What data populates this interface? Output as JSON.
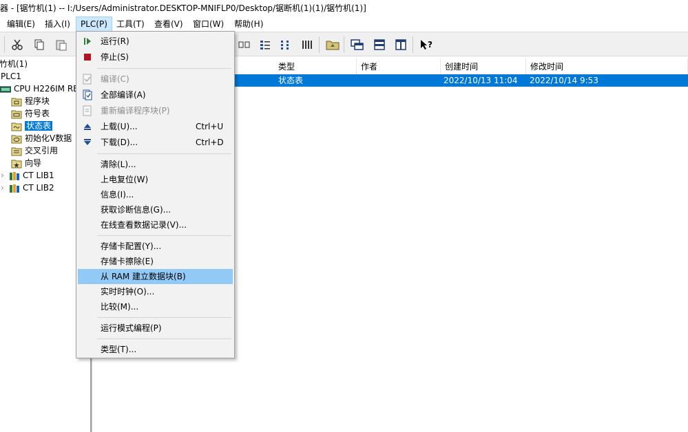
{
  "window": {
    "title": "器 - [锯竹机(1) -- I:/Users/Administrator.DESKTOP-MNIFLP0/Desktop/锯断机(1)(1)/锯竹机(1)]"
  },
  "menubar": {
    "items": [
      "编辑(E)",
      "插入(I)",
      "PLC(P)",
      "工具(T)",
      "查看(V)",
      "窗口(W)",
      "帮助(H)"
    ]
  },
  "tree": {
    "project": "竹机(1)",
    "plc": "PLC1",
    "cpu": "CPU H226IM RE",
    "items": [
      "程序块",
      "符号表",
      "状态表",
      "初始化V数据",
      "交叉引用",
      "向导",
      "CT LIB1",
      "CT LIB2"
    ]
  },
  "table": {
    "headers": [
      "类型",
      "作者",
      "创建时间",
      "修改时间"
    ],
    "rows": [
      {
        "type": "状态表",
        "author": "",
        "created": "2022/10/13 11:04",
        "modified": "2022/10/14 9:53"
      }
    ]
  },
  "plc_menu": {
    "items": [
      {
        "label": "运行(R)",
        "shortcut": "",
        "icon": "run-icon",
        "disabled": false
      },
      {
        "label": "停止(S)",
        "shortcut": "",
        "icon": "stop-icon",
        "disabled": false
      },
      {
        "label": "编译(C)",
        "shortcut": "",
        "icon": "compile-icon",
        "disabled": true
      },
      {
        "label": "全部编译(A)",
        "shortcut": "",
        "icon": "compile-all-icon",
        "disabled": false
      },
      {
        "label": "重新编译程序块(P)",
        "shortcut": "",
        "icon": "recompile-icon",
        "disabled": true
      },
      {
        "label": "上载(U)...",
        "shortcut": "Ctrl+U",
        "icon": "upload-icon",
        "disabled": false
      },
      {
        "label": "下载(D)...",
        "shortcut": "Ctrl+D",
        "icon": "download-icon",
        "disabled": false
      },
      {
        "label": "清除(L)...",
        "shortcut": "",
        "icon": "",
        "disabled": false
      },
      {
        "label": "上电复位(W)",
        "shortcut": "",
        "icon": "",
        "disabled": false
      },
      {
        "label": "信息(I)...",
        "shortcut": "",
        "icon": "",
        "disabled": false
      },
      {
        "label": "获取诊断信息(G)...",
        "shortcut": "",
        "icon": "",
        "disabled": false
      },
      {
        "label": "在线查看数据记录(V)...",
        "shortcut": "",
        "icon": "",
        "disabled": false
      },
      {
        "label": "存储卡配置(Y)...",
        "shortcut": "",
        "icon": "",
        "disabled": false
      },
      {
        "label": "存储卡擦除(E)",
        "shortcut": "",
        "icon": "",
        "disabled": false
      },
      {
        "label": "从 RAM 建立数据块(B)",
        "shortcut": "",
        "icon": "",
        "disabled": false,
        "highlighted": true
      },
      {
        "label": "实时时钟(O)...",
        "shortcut": "",
        "icon": "",
        "disabled": false
      },
      {
        "label": "比较(M)...",
        "shortcut": "",
        "icon": "",
        "disabled": false
      },
      {
        "label": "运行模式编程(P)",
        "shortcut": "",
        "icon": "",
        "disabled": false
      },
      {
        "label": "类型(T)...",
        "shortcut": "",
        "icon": "",
        "disabled": false
      }
    ]
  },
  "colors": {
    "selection": "#0078d7",
    "menu_highlight": "#91c9f7",
    "menubar_active": "#cce8ff"
  }
}
